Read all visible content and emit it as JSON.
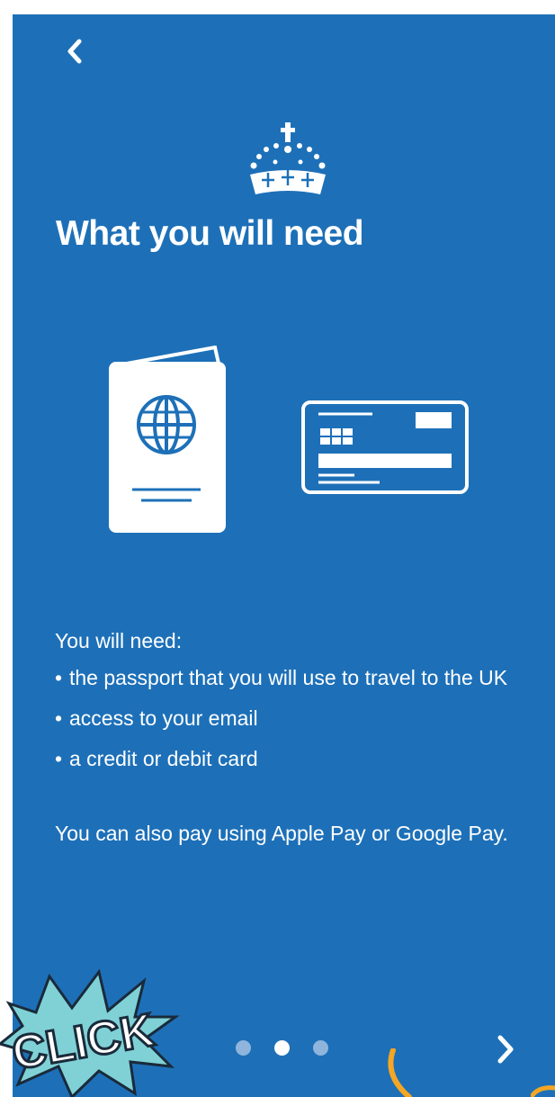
{
  "header": {
    "back_icon": "chevron-left-icon",
    "logo_icon": "crown-icon",
    "title": "What you will need"
  },
  "illustrations": {
    "passport_icon": "passport-icon",
    "card_icon": "credit-card-icon"
  },
  "content": {
    "intro": "You will need:",
    "items": [
      "the passport that you will use to travel to the UK",
      "access to your email",
      "a credit or debit card"
    ],
    "note": "You can also pay using Apple Pay or Google Pay."
  },
  "pager": {
    "pages": 3,
    "current": 2,
    "next_icon": "chevron-right-icon"
  },
  "overlay": {
    "click_text": "CLICK"
  },
  "colors": {
    "background": "#1d70b8",
    "text": "#ffffff",
    "inactive_dot": "#8fb5dc",
    "sticker_fill": "#7fd1d6",
    "accent": "#f5a623"
  }
}
